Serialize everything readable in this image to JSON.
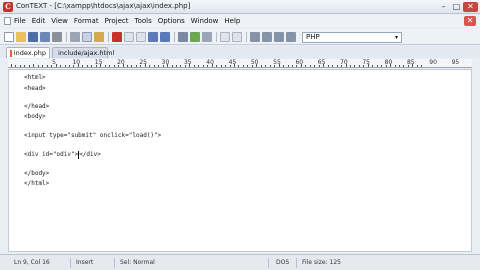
{
  "window": {
    "app_icon_letter": "C",
    "title": "ConTEXT - [C:\\xampp\\htdocs\\ajax\\ajax\\index.php]",
    "minimize_glyph": "–",
    "maximize_glyph": "□",
    "close_glyph": "✕"
  },
  "menu": {
    "items": [
      "File",
      "Edit",
      "View",
      "Format",
      "Project",
      "Tools",
      "Options",
      "Window",
      "Help"
    ],
    "close_glyph": "✕"
  },
  "toolbar": {
    "language": "PHP",
    "dropdown_glyph": "▾",
    "icons": [
      "new-file-icon",
      "open-file-icon",
      "save-icon",
      "save-all-icon",
      "print-icon",
      "cut-icon",
      "copy-icon",
      "paste-icon",
      "undo-icon",
      "redo-icon",
      "find-icon",
      "replace-icon",
      "bookmark-icon",
      "bookmark-next-icon",
      "indent-icon",
      "outdent-icon",
      "comment-icon",
      "uncomment-icon",
      "word-wrap-icon"
    ]
  },
  "tabs": [
    {
      "label": "index.php",
      "active": true
    },
    {
      "label": "include/ajax.html",
      "active": false
    }
  ],
  "ruler": {
    "marks": [
      "5",
      "10",
      "15",
      "20",
      "25",
      "30",
      "35",
      "40",
      "45",
      "50",
      "55",
      "60",
      "65",
      "70",
      "75",
      "80",
      "85",
      "90",
      "95"
    ]
  },
  "editor": {
    "lines": [
      "<html>",
      "<head>",
      "",
      "</head>",
      "<body>",
      "",
      "<input type=\"submit\" onclick=\"load()\">",
      "",
      "<div id=\"odiv\">",
      "",
      "</body>",
      "</html>"
    ],
    "caret_line": 8,
    "caret_after": "<div id=\"odiv\">",
    "caret_rest": "</div>"
  },
  "status": {
    "position": "Ln 9, Col 16",
    "mode": "Insert",
    "format": "Sel: Normal",
    "encoding": "DOS",
    "file_size": "File size: 125"
  },
  "colors": {
    "close_button": "#c8473f",
    "app_icon": "#c9302c",
    "editor_bg": "#ffffff",
    "chrome_bg": "#eef1f6"
  }
}
